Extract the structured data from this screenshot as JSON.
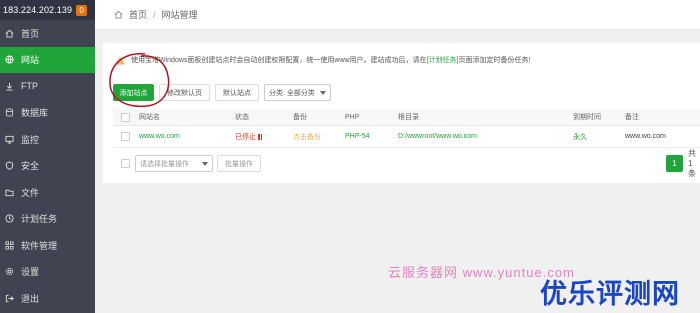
{
  "server": {
    "ip": "183.224.202.139",
    "badge": "0"
  },
  "sidebar": {
    "items": [
      {
        "label": "首页",
        "icon": "home-icon",
        "active": false
      },
      {
        "label": "网站",
        "icon": "globe-icon",
        "active": true
      },
      {
        "label": "FTP",
        "icon": "ftp-icon",
        "active": false
      },
      {
        "label": "数据库",
        "icon": "database-icon",
        "active": false
      },
      {
        "label": "监控",
        "icon": "monitor-icon",
        "active": false
      },
      {
        "label": "安全",
        "icon": "shield-icon",
        "active": false
      },
      {
        "label": "文件",
        "icon": "folder-icon",
        "active": false
      },
      {
        "label": "计划任务",
        "icon": "clock-icon",
        "active": false
      },
      {
        "label": "软件管理",
        "icon": "grid-icon",
        "active": false
      },
      {
        "label": "设置",
        "icon": "gear-icon",
        "active": false
      },
      {
        "label": "退出",
        "icon": "logout-icon",
        "active": false
      }
    ]
  },
  "breadcrumb": {
    "home": "首页",
    "separator": "/",
    "current": "网站管理"
  },
  "notice": {
    "text_before": "使用宝塔Windows面板创建站点时会自动创建权限配置，统一使用www用户。建站成功后，请在",
    "link": "[计划任务]",
    "text_after": "页面添加定时备份任务!"
  },
  "toolbar": {
    "add_site": "添加站点",
    "default_page": "修改默认页",
    "default_site": "默认站点",
    "category": "分类: 全部分类"
  },
  "table": {
    "headers": {
      "name": "网站名",
      "status": "状态",
      "backup": "备份",
      "php": "PHP",
      "root": "根目录",
      "expire": "到期时间",
      "note": "备注"
    },
    "rows": [
      {
        "name": "www.wo.com",
        "status": "已停止",
        "backup": "点击备份",
        "php": "PHP-54",
        "root": "D:/wwwroot/www.wo.com",
        "expire": "永久",
        "note": "www.wo.com"
      }
    ]
  },
  "footer": {
    "batch_placeholder": "请选择批量操作",
    "batch_button": "批量操作",
    "page": "1",
    "total": "共1条"
  },
  "watermark": {
    "small": "云服务器网 www.yuntue.com",
    "big": "优乐评测网"
  },
  "colors": {
    "accent": "#20a53a",
    "sidebar": "#3f4450",
    "danger": "#e3321e",
    "warning": "#f0ad4e",
    "badge": "#e8720c"
  }
}
